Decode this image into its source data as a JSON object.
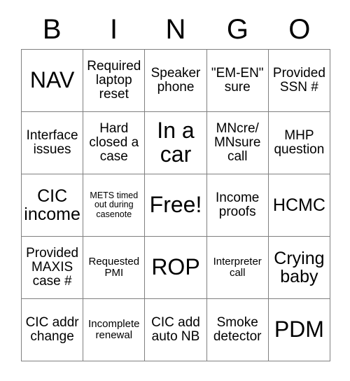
{
  "card": {
    "title": "BINGO",
    "header_letters": [
      "B",
      "I",
      "N",
      "G",
      "O"
    ],
    "rows": [
      [
        {
          "text": "NAV",
          "size": "xl"
        },
        {
          "text": "Required laptop reset",
          "size": "md"
        },
        {
          "text": "Speaker phone",
          "size": "md"
        },
        {
          "text": "\"EM-EN\" sure",
          "size": "md"
        },
        {
          "text": "Provided SSN #",
          "size": "md"
        }
      ],
      [
        {
          "text": "Interface issues",
          "size": "md"
        },
        {
          "text": "Hard closed a case",
          "size": "md"
        },
        {
          "text": "In a car",
          "size": "xl"
        },
        {
          "text": "MNcre/ MNsure call",
          "size": "md"
        },
        {
          "text": "MHP question",
          "size": "md"
        }
      ],
      [
        {
          "text": "CIC income",
          "size": "lg"
        },
        {
          "text": "METS timed out during casenote",
          "size": "xs"
        },
        {
          "text": "Free!",
          "size": "xl"
        },
        {
          "text": "Income proofs",
          "size": "md"
        },
        {
          "text": "HCMC",
          "size": "lg"
        }
      ],
      [
        {
          "text": "Provided MAXIS case #",
          "size": "md"
        },
        {
          "text": "Requested PMI",
          "size": "sm"
        },
        {
          "text": "ROP",
          "size": "xl"
        },
        {
          "text": "Interpreter call",
          "size": "sm"
        },
        {
          "text": "Crying baby",
          "size": "lg"
        }
      ],
      [
        {
          "text": "CIC addr change",
          "size": "md"
        },
        {
          "text": "Incomplete renewal",
          "size": "sm"
        },
        {
          "text": "CIC add auto NB",
          "size": "md"
        },
        {
          "text": "Smoke detector",
          "size": "md"
        },
        {
          "text": "PDM",
          "size": "xl"
        }
      ]
    ]
  }
}
